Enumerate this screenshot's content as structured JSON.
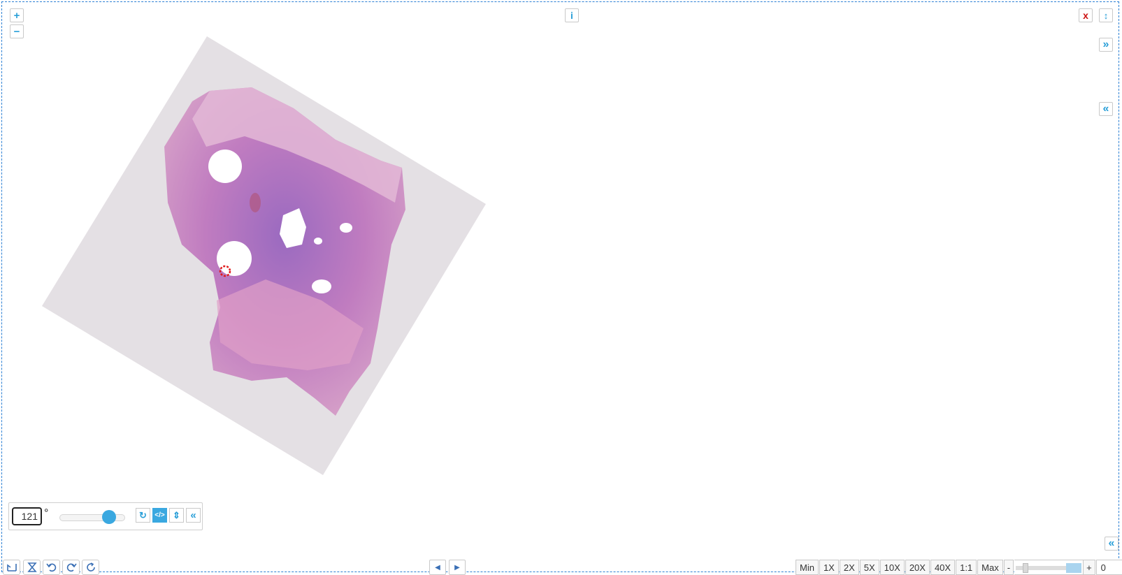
{
  "viewer": {
    "zoom_in_label": "+",
    "zoom_out_label": "−",
    "info_label": "i",
    "close_label": "x",
    "fullheight_label": "↕",
    "expand_right_label": "»",
    "collapse_right_label": "«",
    "collapse_bottom_label": "«"
  },
  "rotation": {
    "angle": "121",
    "degree_symbol": "°",
    "slider_fraction": 0.84,
    "reset_label": "↻",
    "code_label": "</>",
    "flip_label": "⇕",
    "collapse_label": "«"
  },
  "toolbar_left": {
    "icons": [
      "fit-icon",
      "hourglass-icon",
      "undo-icon",
      "redo-icon",
      "refresh-icon"
    ]
  },
  "page_nav": {
    "prev_label": "◀",
    "next_label": "▶"
  },
  "zoom": {
    "presets": [
      "Min",
      "1X",
      "2X",
      "5X",
      "10X",
      "20X",
      "40X",
      "1:1",
      "Max"
    ],
    "minus_label": "-",
    "plus_label": "+",
    "value": "0",
    "close_label": "X"
  },
  "colors": {
    "accent": "#3aa8e0",
    "frame": "#2a7fd4",
    "tissue": "#c47ab8",
    "slide": "#e4e0e4",
    "marker": "#e01b1b"
  }
}
